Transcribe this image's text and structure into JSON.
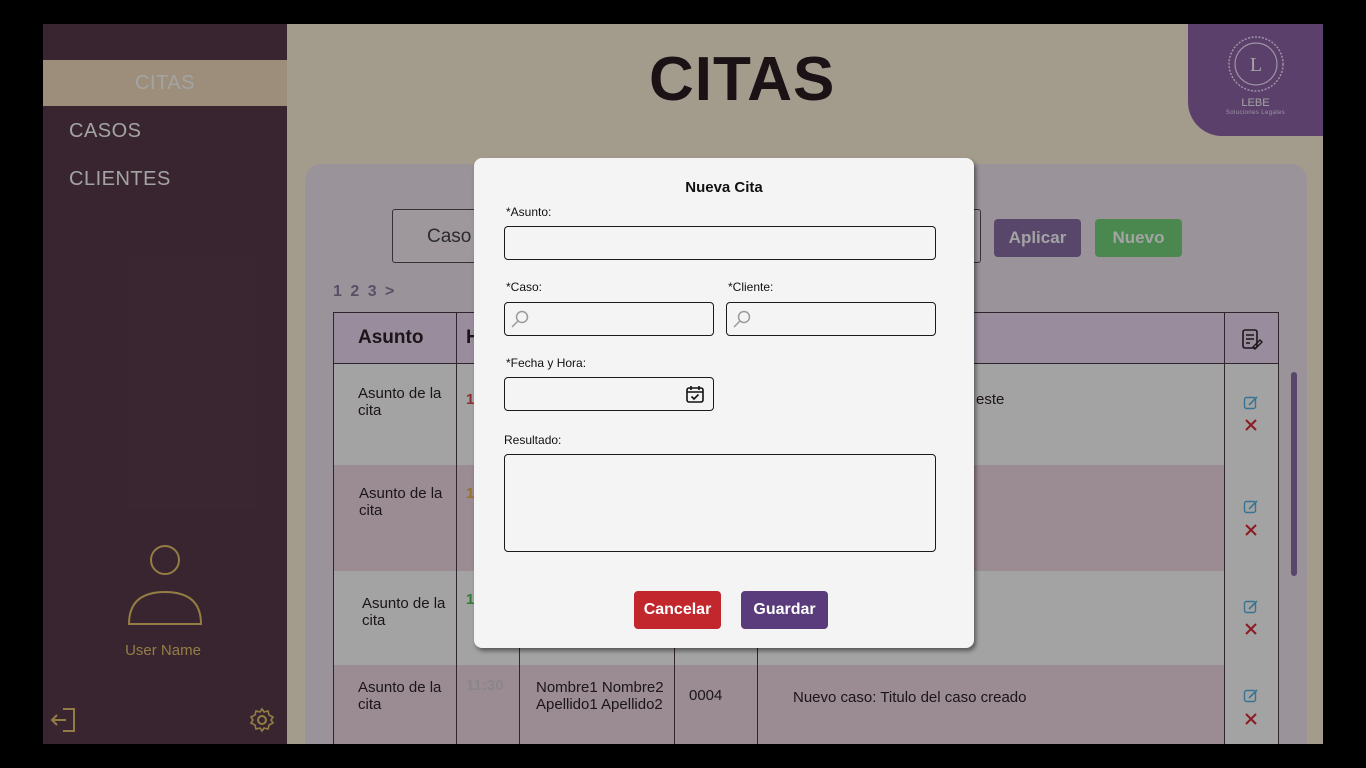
{
  "sidebar": {
    "items": [
      {
        "label": "CITAS",
        "active": true
      },
      {
        "label": "CASOS",
        "active": false
      },
      {
        "label": "CLIENTES",
        "active": false
      }
    ],
    "user_name": "User Name",
    "icons": {
      "avatar": "user-avatar-icon",
      "logout": "logout-icon",
      "settings": "gear-icon"
    }
  },
  "header": {
    "title": "CITAS",
    "logo": {
      "letter": "L",
      "name": "LEBE",
      "tagline": "Soluciones Legales"
    }
  },
  "toolbar": {
    "filter_label": "Caso",
    "apply_label": "Aplicar",
    "new_label": "Nuevo",
    "pagination": "1 2 3 >"
  },
  "table": {
    "columns": [
      "Asunto",
      "H"
    ],
    "rows": [
      {
        "asunto": "Asunto de la cita",
        "hora": "1",
        "hora_color": "#e0454a",
        "tail": "este"
      },
      {
        "asunto": "Asunto de la cita",
        "hora": "1",
        "hora_color": "#f0b24a",
        "tail": ""
      },
      {
        "asunto": "Asunto de la cita",
        "hora": "1",
        "hora_color": "#4cc452",
        "tail": ""
      },
      {
        "asunto": "Asunto de la cita",
        "hora": "11:30",
        "hora_color": "#d8d0d8",
        "cliente": "Nombre1 Nombre2 Apellido1 Apellido2",
        "caso": "0004",
        "resultado": "Nuevo caso: Titulo del caso creado"
      }
    ]
  },
  "modal": {
    "title": "Nueva Cita",
    "asunto_label": "*Asunto:",
    "asunto_value": "",
    "caso_label": "*Caso:",
    "cliente_label": "*Cliente:",
    "fecha_label": "*Fecha y Hora:",
    "resultado_label": "Resultado:",
    "cancel_label": "Cancelar",
    "save_label": "Guardar"
  },
  "colors": {
    "sidebar": "#5a3b4b",
    "accent_purple": "#8a6fa6",
    "accent_green": "#74d57d",
    "cancel_red": "#c3272e",
    "save_purple": "#5a3c7c"
  }
}
